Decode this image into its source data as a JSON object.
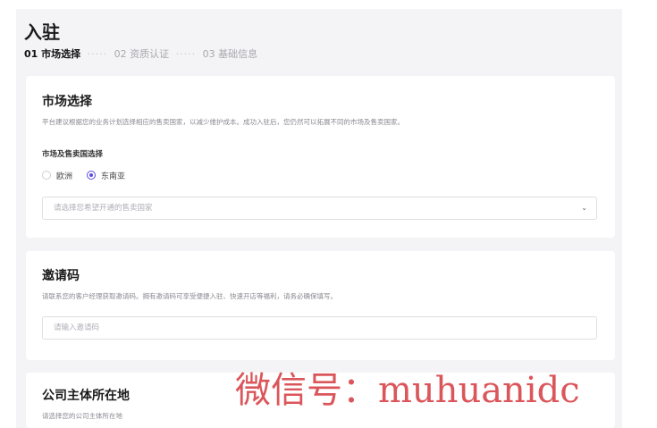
{
  "page": {
    "title": "入驻"
  },
  "steps": [
    {
      "label": "01 市场选择"
    },
    {
      "label": "02 资质认证"
    },
    {
      "label": "03 基础信息"
    }
  ],
  "step_separator": "·····",
  "market": {
    "title": "市场选择",
    "description": "平台建议根据您的业务计划选择相应的售卖国家，以减少维护成本。成功入驻后，您仍然可以拓展不同的市场及售卖国家。",
    "field_label": "市场及售卖国选择",
    "options": [
      {
        "label": "欧洲",
        "checked": false
      },
      {
        "label": "东南亚",
        "checked": true
      }
    ],
    "select_placeholder": "请选择您希望开通的售卖国家"
  },
  "invite": {
    "title": "邀请码",
    "description": "请联系您的客户经理获取邀请码。拥有邀请码可享受便捷入驻、快速开店等福利，请务必确保填写。",
    "input_placeholder": "请输入邀请码"
  },
  "company": {
    "title": "公司主体所在地",
    "description": "请选择您的公司主体所在地"
  },
  "watermark": "微信号：muhuanidc",
  "colors": {
    "accent": "#5b4de0",
    "watermark": "#d8484d"
  }
}
